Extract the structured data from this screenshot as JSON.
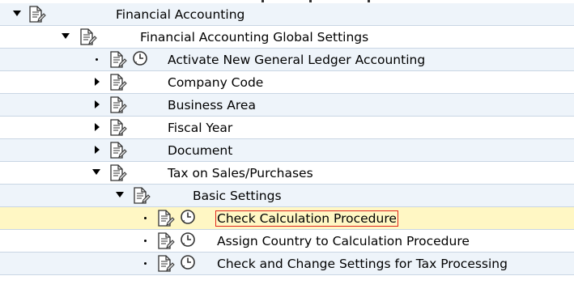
{
  "tree": {
    "nodes": [
      {
        "label": "Financial Accounting",
        "state": "expanded",
        "level": 0,
        "executable": false
      },
      {
        "label": "Financial Accounting Global Settings",
        "state": "expanded",
        "level": 1,
        "executable": false
      },
      {
        "label": "Activate New General Ledger Accounting",
        "state": "leaf",
        "level": 2,
        "executable": true
      },
      {
        "label": "Company Code",
        "state": "collapsed",
        "level": 2,
        "executable": false
      },
      {
        "label": "Business Area",
        "state": "collapsed",
        "level": 2,
        "executable": false
      },
      {
        "label": "Fiscal Year",
        "state": "collapsed",
        "level": 2,
        "executable": false
      },
      {
        "label": "Document",
        "state": "collapsed",
        "level": 2,
        "executable": false
      },
      {
        "label": "Tax on Sales/Purchases",
        "state": "expanded",
        "level": 2,
        "executable": false
      },
      {
        "label": "Basic Settings",
        "state": "expanded",
        "level": 3,
        "executable": false
      },
      {
        "label": "Check Calculation Procedure",
        "state": "leaf",
        "level": 4,
        "executable": true,
        "selected": true
      },
      {
        "label": "Assign Country to Calculation Procedure",
        "state": "leaf",
        "level": 4,
        "executable": true
      },
      {
        "label": "Check and Change Settings for Tax Processing",
        "state": "leaf",
        "level": 4,
        "executable": true
      }
    ],
    "icons": {
      "document": "img-document-icon",
      "execute": "execute-clock-icon"
    },
    "colors": {
      "row_alt": "#eef4fa",
      "row_selected": "#fff7c4",
      "focus_border": "#e0241b",
      "row_border": "#c9d6e4"
    }
  }
}
